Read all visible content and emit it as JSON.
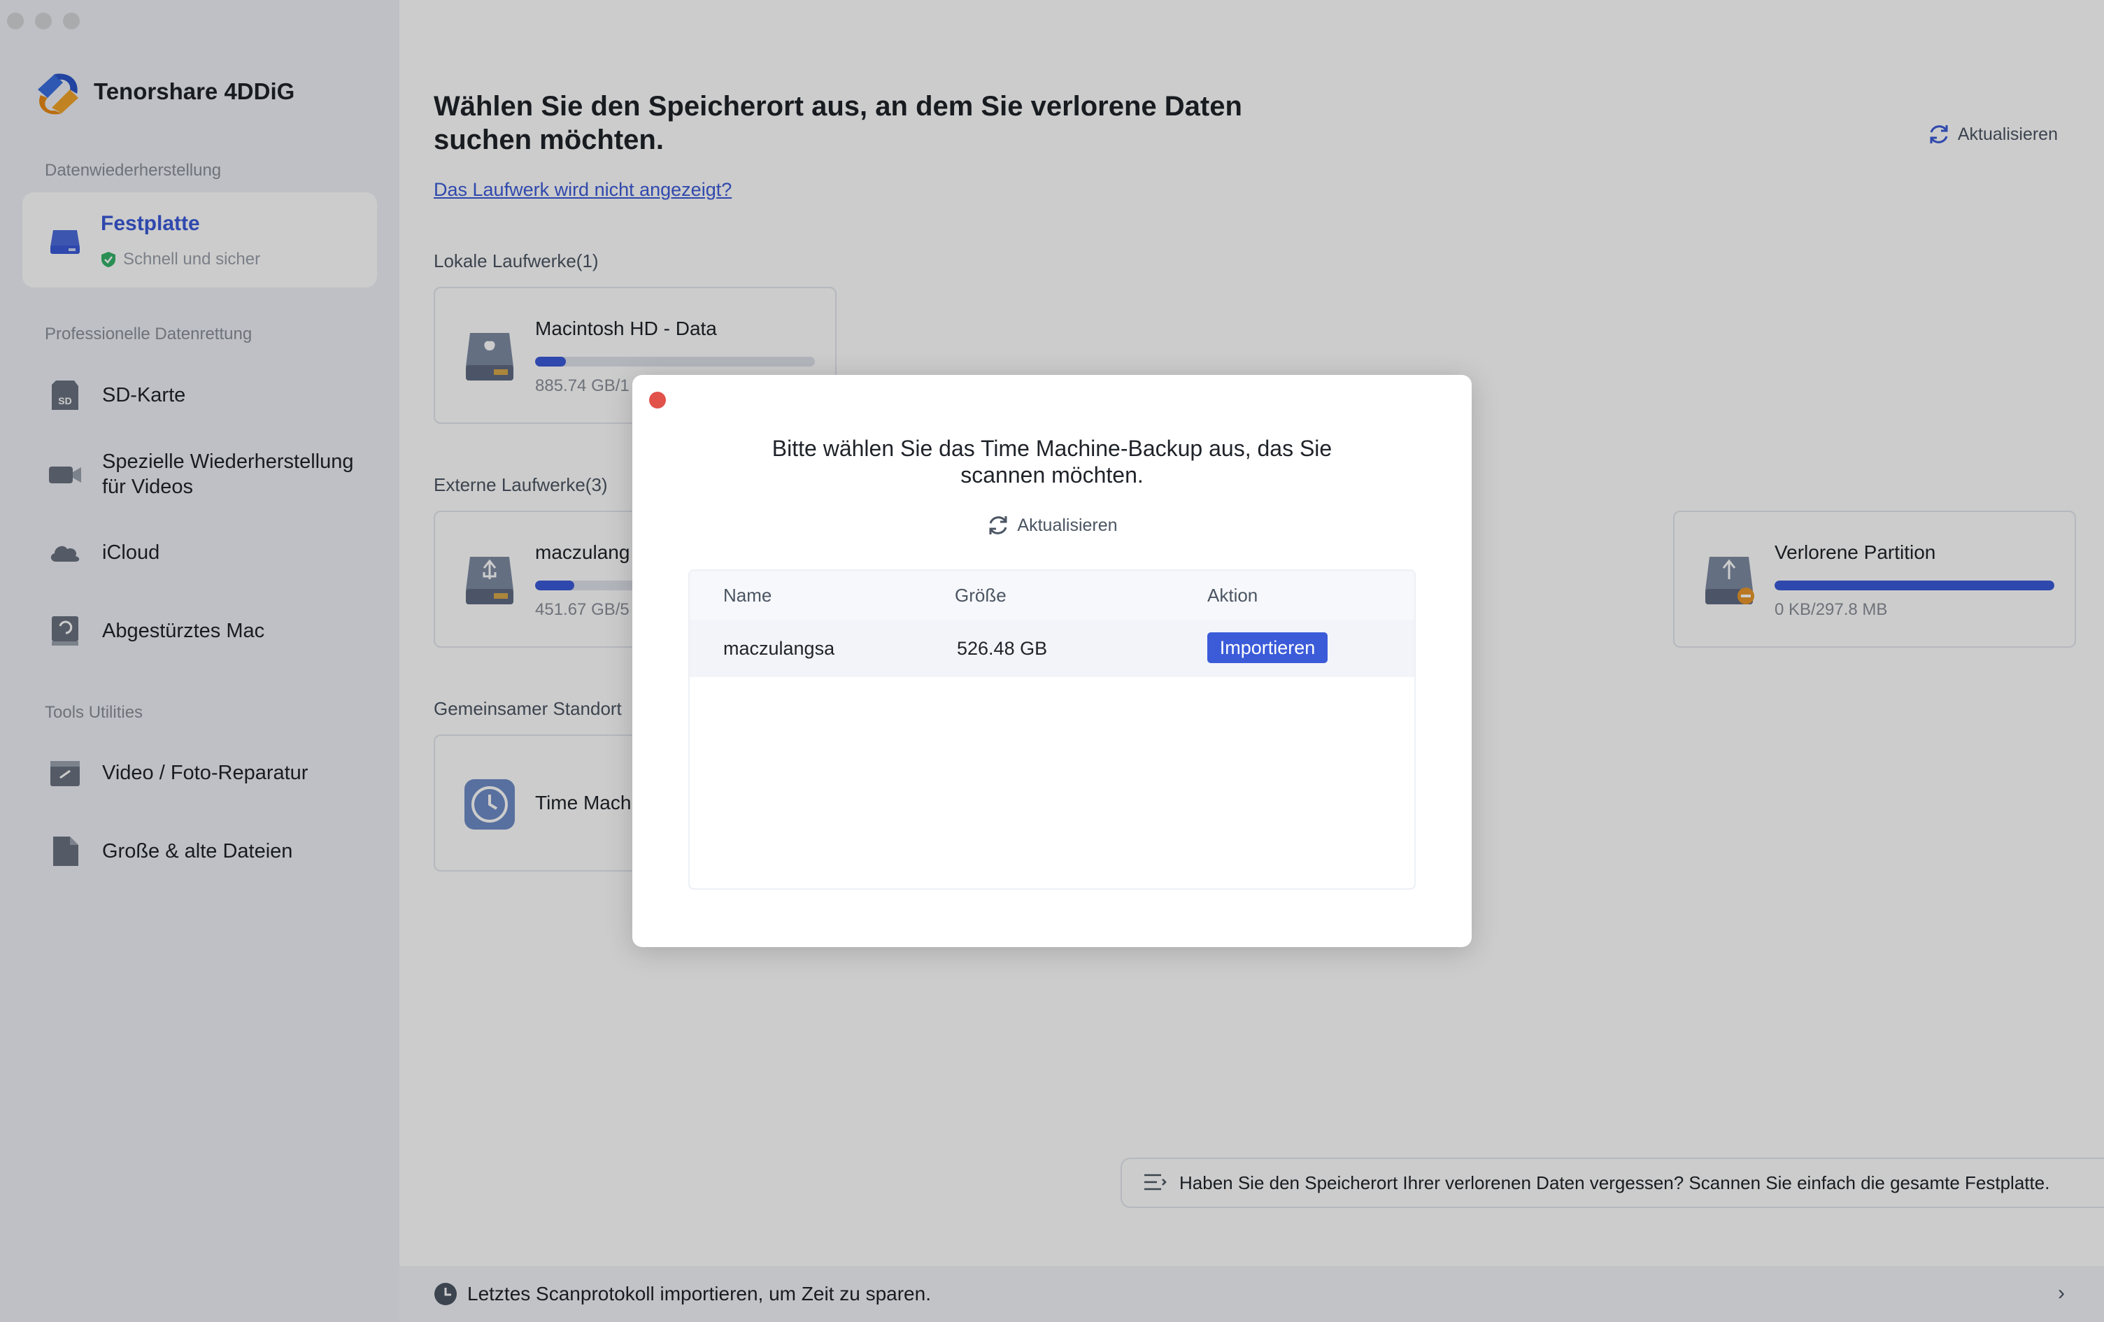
{
  "app": {
    "brand_name": "Tenorshare 4DDiG"
  },
  "sidebar": {
    "section_recovery": "Datenwiederherstellung",
    "active_item": {
      "title": "Festplatte",
      "subtitle": "Schnell und sicher"
    },
    "section_pro": "Professionelle Datenrettung",
    "pro_items": [
      {
        "label": "SD-Karte",
        "icon": "sd-card-icon"
      },
      {
        "label": "Spezielle Wiederherstellung für Videos",
        "icon": "video-camera-icon"
      },
      {
        "label": "iCloud",
        "icon": "cloud-icon"
      },
      {
        "label": "Abgestürztes Mac",
        "icon": "crashed-mac-icon"
      }
    ],
    "section_tools": "Tools  Utilities",
    "tool_items": [
      {
        "label": "Video / Foto-Reparatur",
        "icon": "repair-icon"
      },
      {
        "label": "Große & alte Dateien",
        "icon": "file-icon"
      }
    ]
  },
  "main": {
    "title": "Wählen Sie den Speicherort aus, an dem Sie verlorene Daten suchen möchten.",
    "link": "Das Laufwerk wird nicht angezeigt?",
    "refresh_label": "Aktualisieren",
    "local_label": "Lokale Laufwerke(1)",
    "local_drives": [
      {
        "name": "Macintosh HD - Data",
        "size": "885.74 GB/1",
        "usage": 0.11
      }
    ],
    "external_label": "Externe Laufwerke(3)",
    "external_drives": [
      {
        "name": "maczulang",
        "size": "451.67 GB/5",
        "usage": 0.14
      },
      {
        "name": "Verlorene Partition",
        "size": "0 KB/297.8 MB",
        "usage": 1.0
      }
    ],
    "shared_label": "Gemeinsamer Standort",
    "shared_drives": [
      {
        "name": "Time Machi"
      }
    ],
    "hint": "Haben Sie den Speicherort Ihrer verlorenen Daten vergessen? Scannen Sie einfach die gesamte Festplatte.",
    "bottom_bar": "Letztes Scanprotokoll importieren, um Zeit zu sparen.",
    "bottom_chevron": "›"
  },
  "dialog": {
    "title": "Bitte wählen Sie das Time Machine-Backup aus, das Sie scannen möchten.",
    "refresh_label": "Aktualisieren",
    "columns": {
      "name": "Name",
      "size": "Größe",
      "action": "Aktion"
    },
    "rows": [
      {
        "name": "maczulangsa",
        "size": "526.48 GB",
        "action": "Importieren"
      }
    ]
  },
  "colors": {
    "accent": "#3b5bd9",
    "close": "#e0524a",
    "sidebar_bg": "#eef0f7"
  }
}
